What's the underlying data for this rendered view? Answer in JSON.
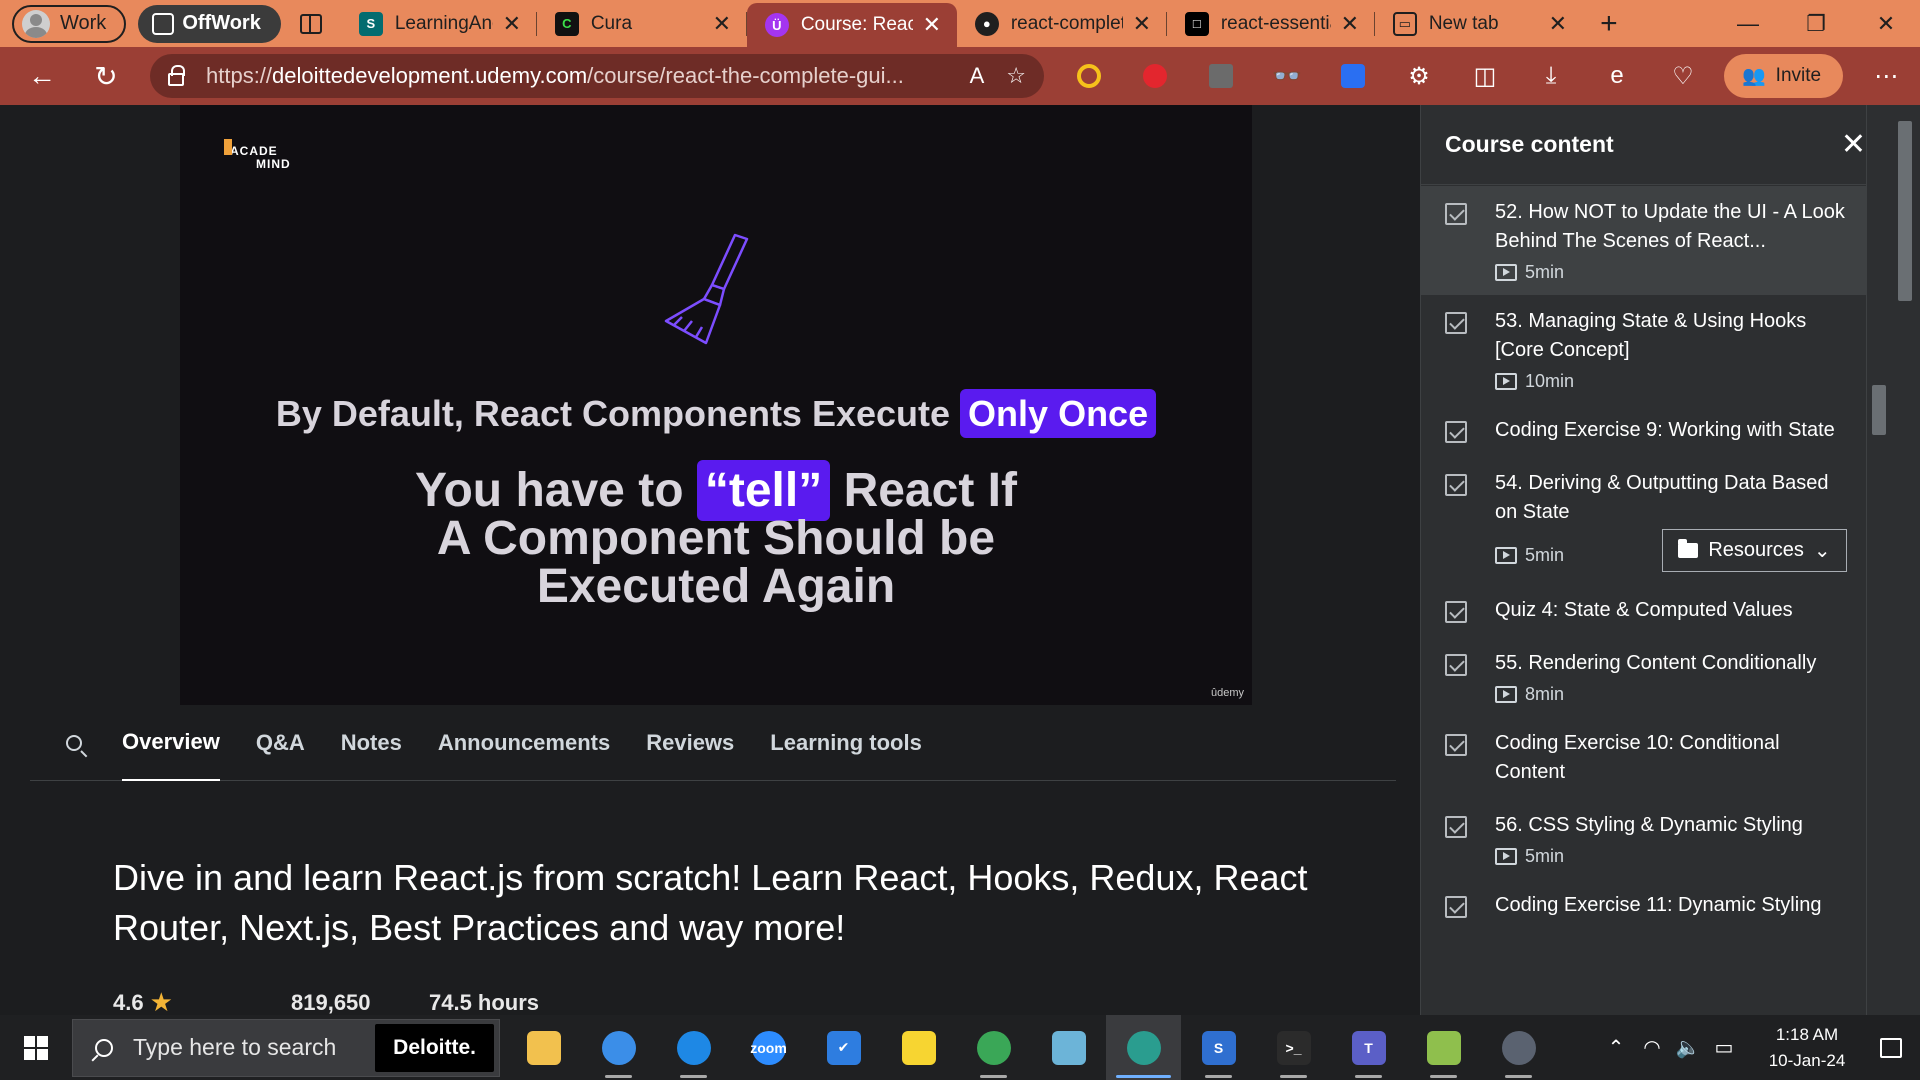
{
  "browser": {
    "profile_label": "Work",
    "workspace_label": "OffWork",
    "tabs": [
      {
        "label": "LearningAndD",
        "icon": "sharepoint-icon",
        "color": "#036c70",
        "active": false
      },
      {
        "label": "Cura",
        "icon": "cura-icon",
        "color": "#111111",
        "active": false
      },
      {
        "label": "Course: React",
        "icon": "udemy-icon",
        "color": "#a435f0",
        "active": true
      },
      {
        "label": "react-complet",
        "icon": "github-icon",
        "color": "#1f1f1f",
        "active": false
      },
      {
        "label": "react-essentia",
        "icon": "codesandbox-icon",
        "color": "#000000",
        "active": false
      },
      {
        "label": "New tab",
        "icon": "new-tab-icon",
        "color": "#1f1f1f",
        "active": false
      }
    ],
    "url_prefix": "https://",
    "url_domain": "deloittedevelopment.udemy.com",
    "url_path": "/course/react-the-complete-gui...",
    "invite_label": "Invite"
  },
  "video": {
    "logo_line1": "ACADE",
    "logo_line2": "MIND",
    "slide_line1_prefix": "By Default, React Components Execute",
    "slide_line1_highlight": "Only Once",
    "slide_line2_prefix": "You have to",
    "slide_line2_highlight": "“tell”",
    "slide_line2_suffix": "React If",
    "slide_line3": "A Component Should be",
    "slide_line4": "Executed Again",
    "watermark": "ûdemy"
  },
  "course_tabs": [
    "Overview",
    "Q&A",
    "Notes",
    "Announcements",
    "Reviews",
    "Learning tools"
  ],
  "description": "Dive in and learn React.js from scratch! Learn React, Hooks, Redux, React Router, Next.js, Best Practices and way more!",
  "stats": {
    "rating": "4.6",
    "students": "819,650",
    "hours": "74.5 hours"
  },
  "panel": {
    "title": "Course content",
    "items": [
      {
        "title": "52. How NOT to Update the UI - A Look Behind The Scenes of React...",
        "duration": "5min",
        "current": true
      },
      {
        "title": "53. Managing State & Using Hooks [Core Concept]",
        "duration": "10min"
      },
      {
        "title": "Coding Exercise 9: Working with State",
        "duration": ""
      },
      {
        "title": "54. Deriving & Outputting Data Based on State",
        "duration": "5min",
        "resources": "Resources"
      },
      {
        "title": "Quiz 4: State & Computed Values",
        "duration": ""
      },
      {
        "title": "55. Rendering Content Conditionally",
        "duration": "8min"
      },
      {
        "title": "Coding Exercise 10: Conditional Content",
        "duration": ""
      },
      {
        "title": "56. CSS Styling & Dynamic Styling",
        "duration": "5min"
      },
      {
        "title": "Coding Exercise 11: Dynamic Styling",
        "duration": ""
      }
    ]
  },
  "taskbar": {
    "search_placeholder": "Type here to search",
    "deloitte_label": "Deloitte.",
    "time": "1:18 AM",
    "date": "10-Jan-24",
    "apps": [
      {
        "name": "file-explorer-icon",
        "color": "#f2c14e",
        "label": ""
      },
      {
        "name": "chrome-icon",
        "color": "#3b8ee8",
        "label": ""
      },
      {
        "name": "edge-icon",
        "color": "#1e88e5",
        "label": ""
      },
      {
        "name": "zoom-icon",
        "color": "#2d8cff",
        "label": "zoom"
      },
      {
        "name": "todo-icon",
        "color": "#2e7de0",
        "label": "✔"
      },
      {
        "name": "sticky-notes-icon",
        "color": "#f7d531",
        "label": ""
      },
      {
        "name": "chrome-profile-icon",
        "color": "#3aa757",
        "label": ""
      },
      {
        "name": "notepad-icon",
        "color": "#6cb4d8",
        "label": ""
      },
      {
        "name": "edge-active-icon",
        "color": "#2a9d8f",
        "label": ""
      },
      {
        "name": "snagit-icon",
        "color": "#2f6fd0",
        "label": "S"
      },
      {
        "name": "terminal-icon",
        "color": "#2b2b2b",
        "label": ">_"
      },
      {
        "name": "teams-icon",
        "color": "#5b5fc7",
        "label": "T"
      },
      {
        "name": "notepadpp-icon",
        "color": "#8fbf4d",
        "label": ""
      },
      {
        "name": "clock-app-icon",
        "color": "#5a6270",
        "label": ""
      }
    ]
  }
}
